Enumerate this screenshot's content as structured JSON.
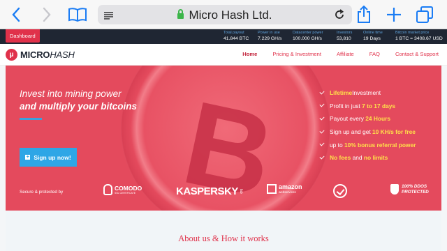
{
  "browser": {
    "url_text": "Micro Hash Ltd."
  },
  "stats_bar": {
    "dashboard_label": "Dashboard",
    "stats": [
      {
        "label": "Total payout",
        "value": "41.844 BTC"
      },
      {
        "label": "Power in use",
        "value": "7.229 GH/s"
      },
      {
        "label": "Datacenter power",
        "value": "100.000 GH/s"
      },
      {
        "label": "Investors",
        "value": "53,810"
      },
      {
        "label": "Online time",
        "value": "19 Days"
      },
      {
        "label": "Bitcoin market price",
        "value": "1 BTC = 3408.67 USD"
      }
    ]
  },
  "site_nav": {
    "logo_mark": "μ",
    "logo_bold": "MICRO",
    "logo_thin": "HASH",
    "menu": [
      {
        "label": "Home",
        "active": true
      },
      {
        "label": "Pricing & Investment",
        "active": false
      },
      {
        "label": "Affiliate",
        "active": false
      },
      {
        "label": "FAQ",
        "active": false
      },
      {
        "label": "Contact & Support",
        "active": false
      }
    ]
  },
  "hero": {
    "title_line1": "Invest into mining power",
    "title_line2": "and multiply your bitcoins",
    "signup_label": "Sign up now!",
    "coin_symbol": "B",
    "features": [
      {
        "pre": "",
        "hl": "Lifetime",
        "post": " Investment"
      },
      {
        "pre": "Profit in just ",
        "hl": "7 to 17 days",
        "post": ""
      },
      {
        "pre": "Payout every ",
        "hl": "24 Hours",
        "post": ""
      },
      {
        "pre": "Sign up and get ",
        "hl": "10 KH/s for free",
        "post": ""
      },
      {
        "pre": "up to ",
        "hl": "10% bonus referral power",
        "post": ""
      },
      {
        "pre": "",
        "hl": "No fees",
        "post": " and ",
        "hl2": "no limits"
      }
    ],
    "secure_label": "Secure & protected by",
    "partners": {
      "comodo": "COMODO",
      "comodo_sub": "SSL CERTIFICATE",
      "kaspersky": "KASPERSKY",
      "kaspersky_lab": "lab",
      "amazon": "amazon",
      "amazon_sub": "webservices",
      "ddos_line1": "100% DDOS",
      "ddos_line2": "PROTECTED"
    }
  },
  "about": {
    "title": "About us & How it works"
  },
  "colors": {
    "brand_red": "#e0314a",
    "hero_red": "#e44a5d",
    "accent_blue": "#2ea6e6",
    "highlight_yellow": "#ffe14a"
  }
}
